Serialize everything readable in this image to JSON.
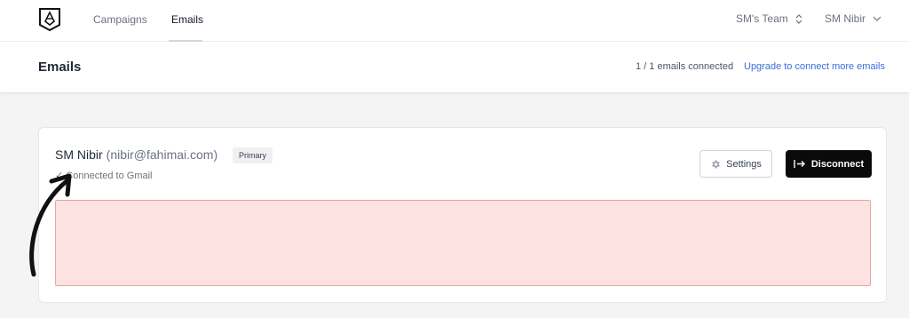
{
  "nav": {
    "tabs": [
      {
        "label": "Campaigns",
        "active": false
      },
      {
        "label": "Emails",
        "active": true
      }
    ],
    "team_label": "SM's Team",
    "user_label": "SM Nibir"
  },
  "header": {
    "title": "Emails",
    "connected_count": "1 / 1 emails connected",
    "upgrade_link": "Upgrade to connect more emails"
  },
  "account": {
    "name": "SM Nibir",
    "email": "(nibir@fahimai.com)",
    "badge": "Primary",
    "status": "✓ Connected to Gmail",
    "settings_label": "Settings",
    "disconnect_label": "Disconnect"
  },
  "colors": {
    "accent_link": "#3b6fd6",
    "redacted_fill": "#fde2e2",
    "redacted_border": "#e7a5a5",
    "disconnect_bg": "#0a0a0a"
  },
  "icons": [
    "logo-icon",
    "chevron-updown-icon",
    "chevron-down-icon",
    "gear-icon",
    "arrow-right-bar-icon",
    "annotation-arrow-icon"
  ]
}
